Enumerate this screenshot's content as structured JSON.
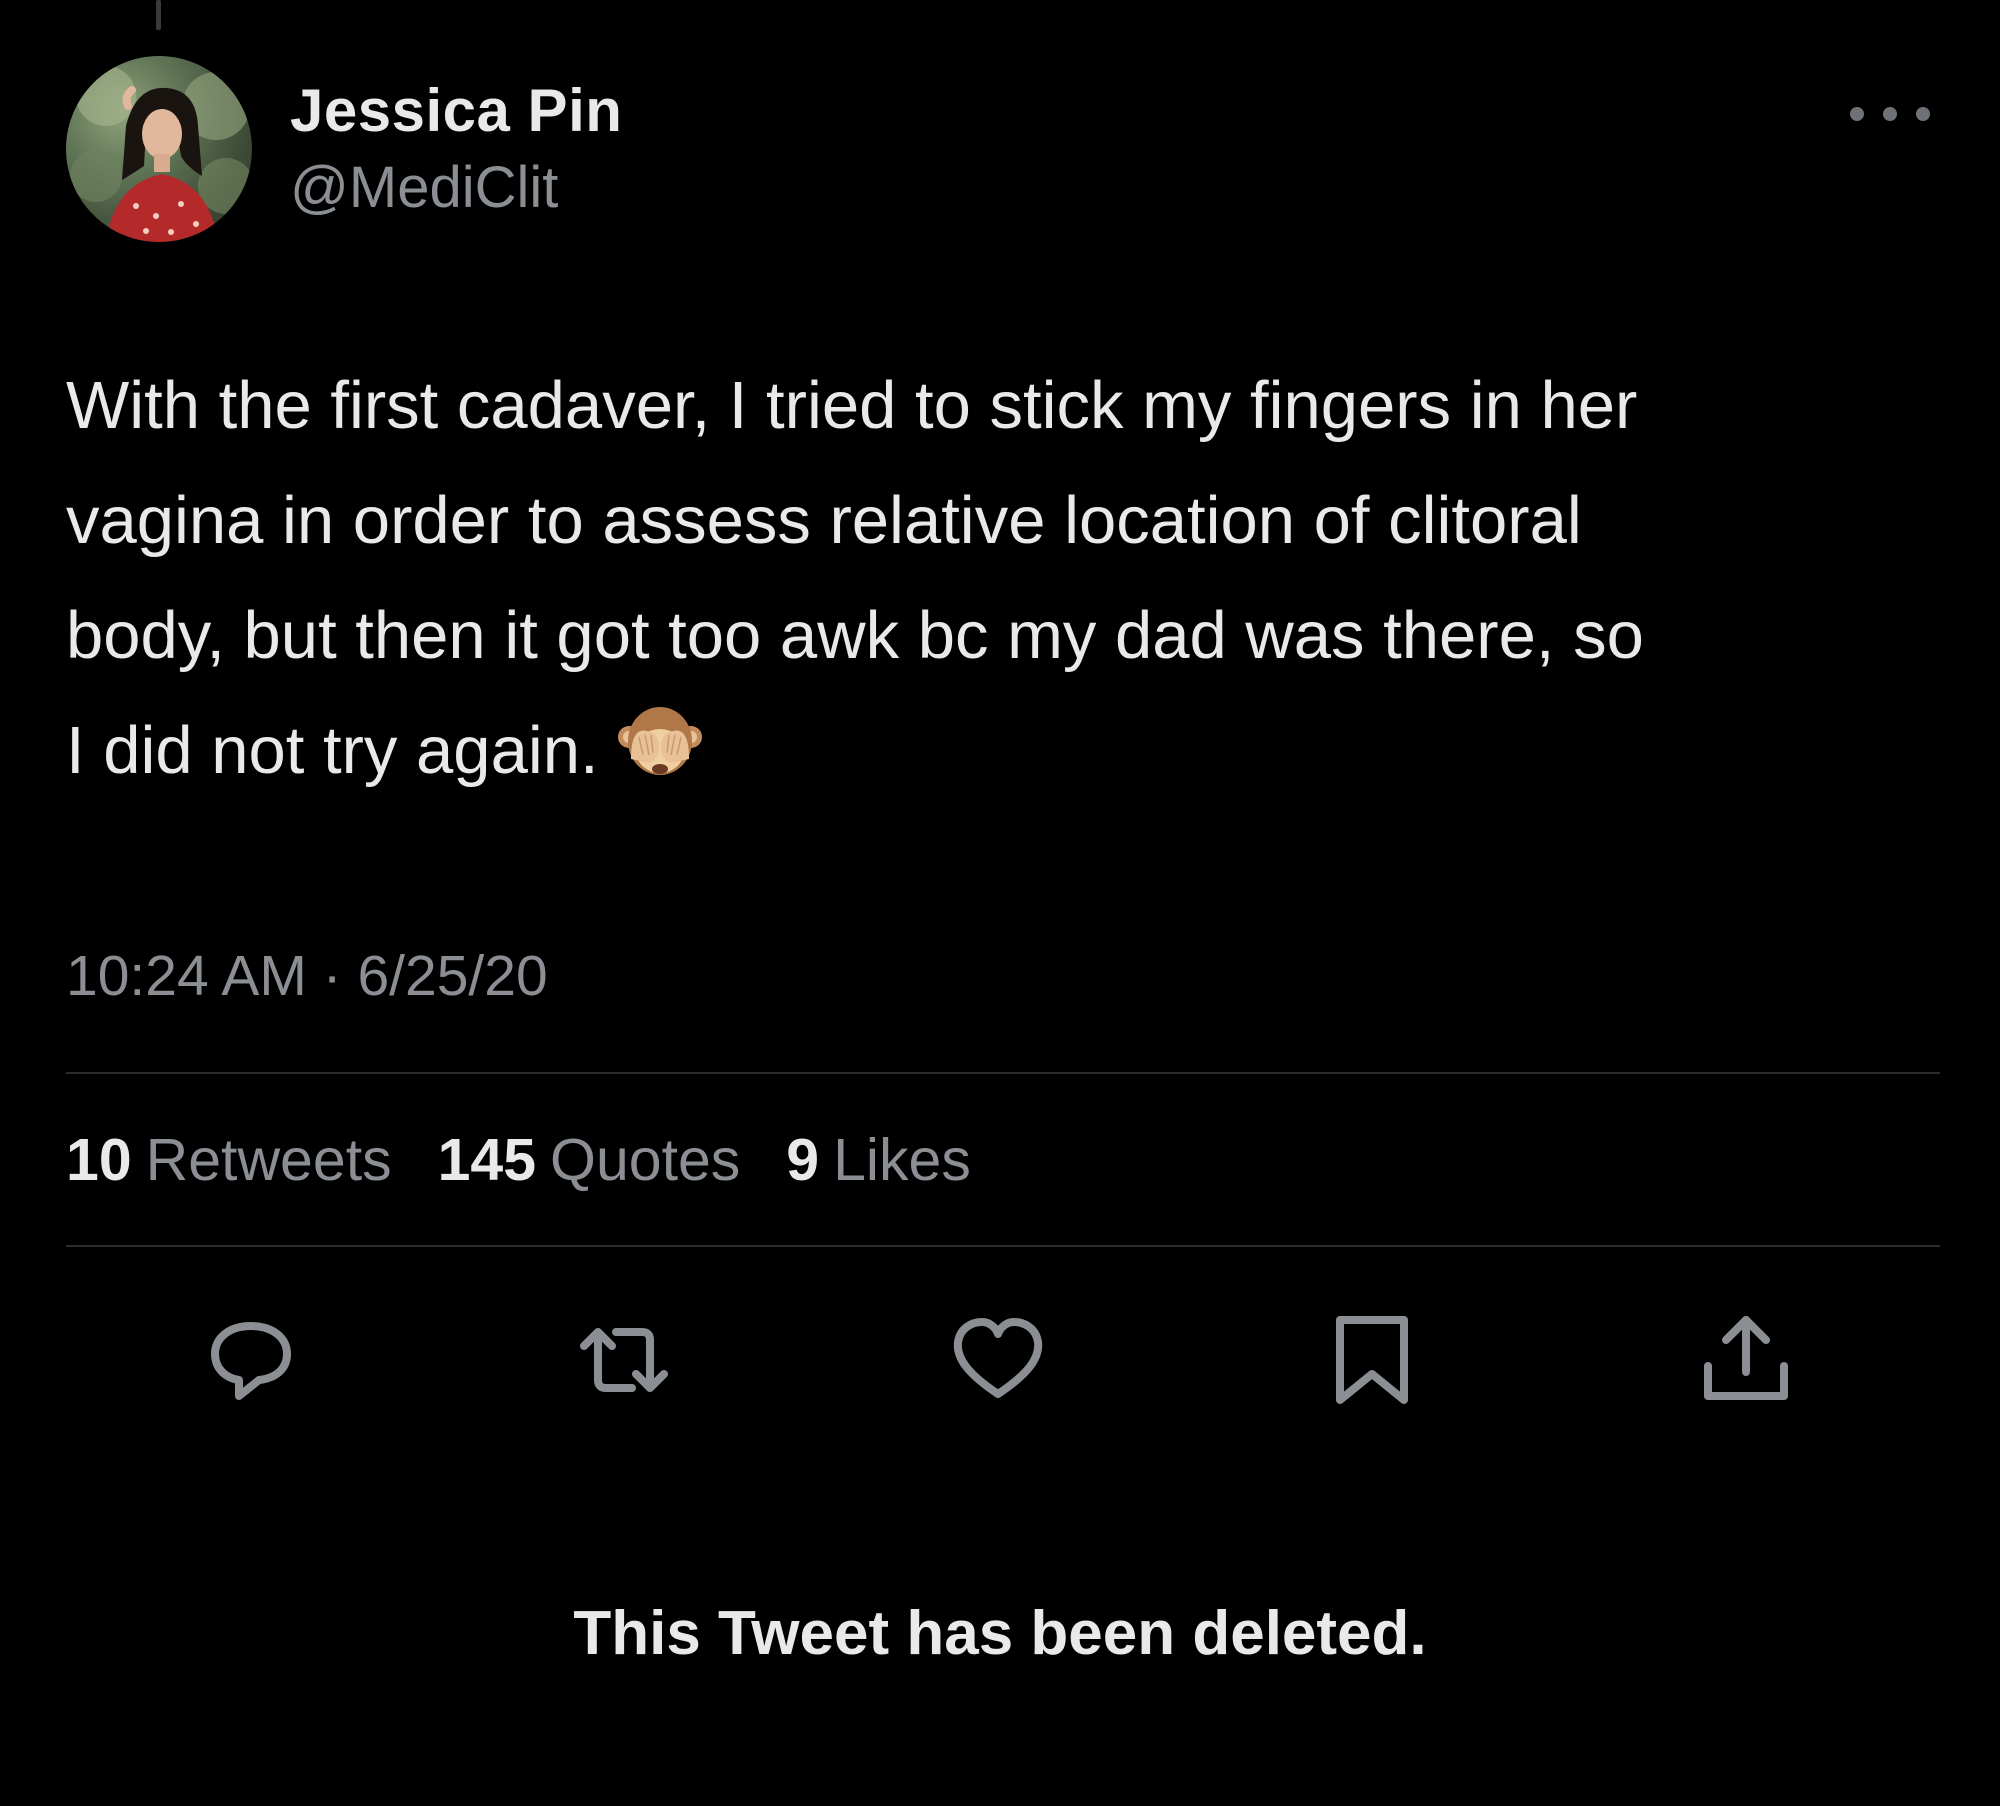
{
  "author": {
    "name": "Jessica Pin",
    "handle": "@MediClit"
  },
  "tweet": {
    "lines": [
      "With the first cadaver, I tried to stick my fingers in her",
      "vagina in order to assess relative location of clitoral",
      "body, but then it got too awk bc my dad was there, so",
      "I did not try again."
    ],
    "emoji": "see-no-evil-monkey",
    "timestamp": "10:24 AM · 6/25/20"
  },
  "stats": {
    "retweets": {
      "count": "10",
      "label": "Retweets"
    },
    "quotes": {
      "count": "145",
      "label": "Quotes"
    },
    "likes": {
      "count": "9",
      "label": "Likes"
    }
  },
  "actions": {
    "icons": [
      "reply-icon",
      "retweet-icon",
      "like-icon",
      "bookmark-icon",
      "share-icon"
    ]
  },
  "deleted_notice": "This Tweet has been deleted.",
  "colors": {
    "background": "#000000",
    "primary_text": "#e7e9ea",
    "secondary_text": "#8b8f94",
    "divider": "#2a2c2f",
    "icon": "#8b8f94"
  }
}
